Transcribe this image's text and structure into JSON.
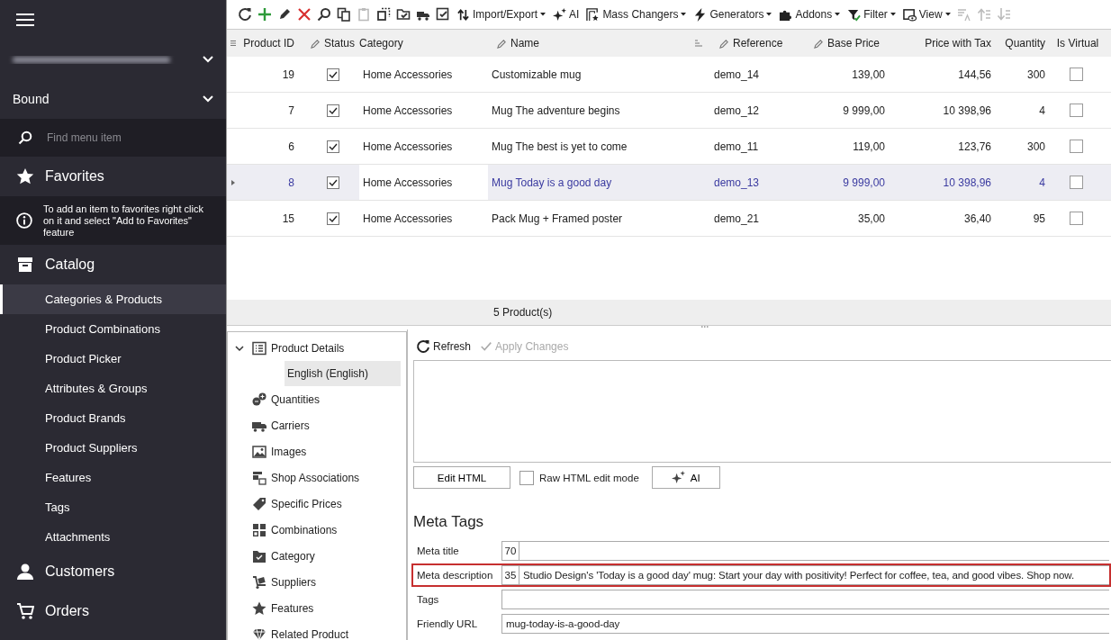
{
  "sidebar": {
    "profile": "Bound",
    "search": {
      "placeholder": "Find menu item"
    },
    "favorites": {
      "label": "Favorites",
      "hint": "To add an item to favorites right click on it and select \"Add to Favorites\" feature"
    },
    "sections": [
      {
        "label": "Catalog",
        "items": [
          {
            "label": "Categories & Products",
            "selected": true
          },
          {
            "label": "Product Combinations",
            "selected": false
          },
          {
            "label": "Product Picker",
            "selected": false
          },
          {
            "label": "Attributes & Groups",
            "selected": false
          },
          {
            "label": "Product Brands",
            "selected": false
          },
          {
            "label": "Product Suppliers",
            "selected": false
          },
          {
            "label": "Features",
            "selected": false
          },
          {
            "label": "Tags",
            "selected": false
          },
          {
            "label": "Attachments",
            "selected": false
          }
        ]
      },
      {
        "label": "Customers"
      },
      {
        "label": "Orders"
      }
    ]
  },
  "toolbar": [
    {
      "kind": "icon",
      "disabled": false
    },
    {
      "kind": "icon",
      "disabled": false
    },
    {
      "kind": "icon",
      "disabled": false
    },
    {
      "kind": "icon",
      "disabled": false
    },
    {
      "kind": "icon",
      "disabled": false
    },
    {
      "kind": "icon",
      "disabled": false
    },
    {
      "kind": "icon",
      "disabled": true
    },
    {
      "kind": "icon",
      "disabled": false
    },
    {
      "kind": "icon",
      "disabled": false
    },
    {
      "kind": "icon",
      "disabled": false
    },
    {
      "kind": "icon",
      "disabled": false
    },
    {
      "kind": "menu",
      "label": "Import/Export",
      "disabled": false
    },
    {
      "kind": "button",
      "label": "AI",
      "disabled": false
    },
    {
      "kind": "menu",
      "label": "Mass Changers",
      "disabled": false
    },
    {
      "kind": "menu",
      "label": "Generators",
      "disabled": false
    },
    {
      "kind": "menu",
      "label": "Addons",
      "disabled": false
    },
    {
      "kind": "menu",
      "label": "Filter",
      "disabled": false
    },
    {
      "kind": "menu",
      "label": "View",
      "disabled": false
    },
    {
      "kind": "icon",
      "disabled": true
    },
    {
      "kind": "icon",
      "disabled": true
    },
    {
      "kind": "icon",
      "disabled": true
    }
  ],
  "grid": {
    "columns": [
      {
        "label": "Product ID",
        "editable": false
      },
      {
        "label": "Status",
        "editable": true
      },
      {
        "label": "Category",
        "editable": false
      },
      {
        "label": "Name",
        "editable": true,
        "sort_icon": true
      },
      {
        "label": "Reference",
        "editable": true
      },
      {
        "label": "Base Price",
        "editable": true
      },
      {
        "label": "Price with Tax",
        "editable": false
      },
      {
        "label": "Quantity",
        "editable": false
      },
      {
        "label": "Is Virtual",
        "editable": false
      }
    ],
    "rows": [
      {
        "id": "19",
        "status": true,
        "category": "Home Accessories",
        "name": "Customizable mug",
        "reference": "demo_14",
        "base_price": "139,00",
        "price_with_tax": "144,56",
        "quantity": "300",
        "is_virtual": false,
        "selected": false
      },
      {
        "id": "7",
        "status": true,
        "category": "Home Accessories",
        "name": "Mug The adventure begins",
        "reference": "demo_12",
        "base_price": "9 999,00",
        "price_with_tax": "10 398,96",
        "quantity": "4",
        "is_virtual": false,
        "selected": false
      },
      {
        "id": "6",
        "status": true,
        "category": "Home Accessories",
        "name": "Mug The best is yet to come",
        "reference": "demo_11",
        "base_price": "119,00",
        "price_with_tax": "123,76",
        "quantity": "300",
        "is_virtual": false,
        "selected": false
      },
      {
        "id": "8",
        "status": true,
        "category": "Home Accessories",
        "name": "Mug Today is a good day",
        "reference": "demo_13",
        "base_price": "9 999,00",
        "price_with_tax": "10 398,96",
        "quantity": "4",
        "is_virtual": false,
        "selected": true
      },
      {
        "id": "15",
        "status": true,
        "category": "Home Accessories",
        "name": "Pack Mug + Framed poster",
        "reference": "demo_21",
        "base_price": "35,00",
        "price_with_tax": "36,40",
        "quantity": "95",
        "is_virtual": false,
        "selected": false
      }
    ],
    "footer": "5 Product(s)"
  },
  "tree": [
    {
      "label": "Product Details",
      "expanded": true,
      "selected": false,
      "children": [
        {
          "label": "English (English)",
          "selected": true
        }
      ]
    },
    {
      "label": "Quantities",
      "selected": false
    },
    {
      "label": "Carriers",
      "selected": false
    },
    {
      "label": "Images",
      "selected": false
    },
    {
      "label": "Shop Associations",
      "selected": false
    },
    {
      "label": "Specific Prices",
      "selected": false
    },
    {
      "label": "Combinations",
      "selected": false
    },
    {
      "label": "Category",
      "selected": false
    },
    {
      "label": "Suppliers",
      "selected": false
    },
    {
      "label": "Features",
      "selected": false
    },
    {
      "label": "Related Product",
      "selected": false
    }
  ],
  "details": {
    "actions": [
      {
        "label": "Refresh",
        "disabled": false
      },
      {
        "label": "Apply Changes",
        "disabled": true
      }
    ],
    "edit_html": "Edit HTML",
    "raw_html": {
      "label": "Raw HTML edit mode",
      "checked": false
    },
    "ai": "AI",
    "heading": "Meta Tags",
    "fields": [
      {
        "label": "Meta title",
        "count": "70",
        "highlighted": false
      },
      {
        "label": "Meta description",
        "count": "35",
        "value": "Studio Design's 'Today is a good day' mug: Start your day with positivity! Perfect for coffee, tea, and good vibes. Shop now.",
        "highlighted": true
      },
      {
        "label": "Tags",
        "highlighted": false
      },
      {
        "label": "Friendly URL",
        "value": "mug-today-is-a-good-day",
        "highlighted": false
      }
    ]
  }
}
